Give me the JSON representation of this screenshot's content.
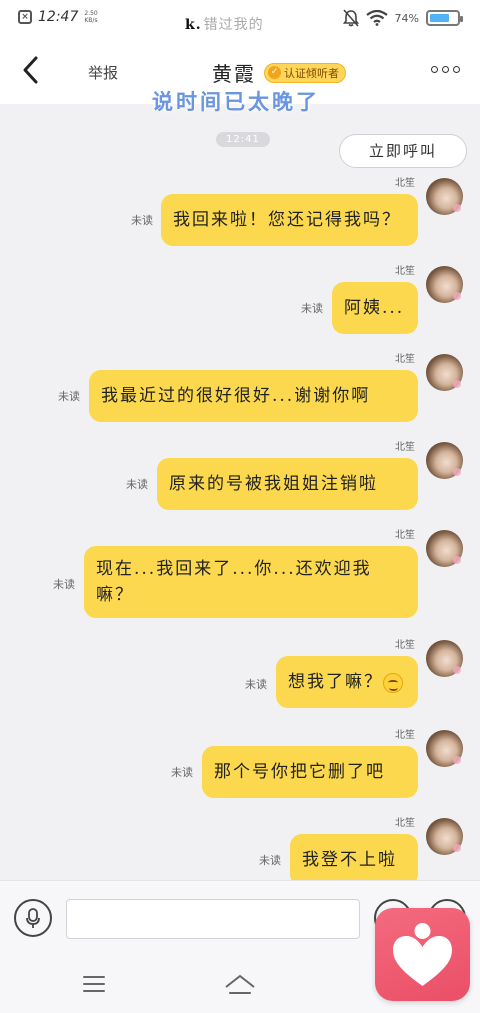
{
  "status_bar": {
    "time": "12:47",
    "net_speed": "2.50 KB/s",
    "center_fragment_dark": "k.",
    "center_fragment_light": "错过我的",
    "battery_percent": "74%",
    "battery_level": 0.74,
    "battery_color": "#4fb3f6"
  },
  "nav": {
    "report_label": "举报",
    "contact_name": "黄霞",
    "badge_label": "认证倾听者",
    "overlay_caption": "说时间已太晚了"
  },
  "chat": {
    "timestamp": "12:41",
    "call_button": "立即呼叫",
    "messages": [
      {
        "sender": "北笙",
        "text": "我回来啦！您还记得我吗？",
        "status": "未读"
      },
      {
        "sender": "北笙",
        "text": "阿姨...",
        "status": "未读"
      },
      {
        "sender": "北笙",
        "text": "我最近过的很好很好...谢谢你啊",
        "status": "未读"
      },
      {
        "sender": "北笙",
        "text": "原来的号被我姐姐注销啦",
        "status": "未读"
      },
      {
        "sender": "北笙",
        "text": "现在...我回来了...你...还欢迎我嘛？",
        "status": "未读"
      },
      {
        "sender": "北笙",
        "text": "想我了嘛？",
        "status": "未读",
        "emoji": "smile-emoji"
      },
      {
        "sender": "北笙",
        "text": "那个号你把它删了吧",
        "status": "未读"
      },
      {
        "sender": "北笙",
        "text": "我登不上啦",
        "status": "未读"
      }
    ]
  },
  "input": {
    "placeholder": ""
  },
  "colors": {
    "bubble": "#fbd84d",
    "badge": "#ffd65a",
    "app_logo": "#ea4f67"
  }
}
